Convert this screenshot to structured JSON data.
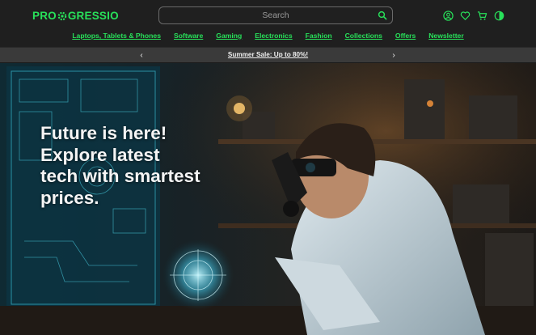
{
  "brand": {
    "name_left": "PRO",
    "name_right": "GRESSIO",
    "accent": "#28e05a"
  },
  "search": {
    "placeholder": "Search",
    "icon": "search-icon"
  },
  "header_icons": [
    "user-icon",
    "heart-icon",
    "cart-icon",
    "theme-toggle-icon"
  ],
  "nav": {
    "items": [
      {
        "label": "Laptops, Tablets & Phones"
      },
      {
        "label": "Software"
      },
      {
        "label": "Gaming"
      },
      {
        "label": "Electronics"
      },
      {
        "label": "Fashion"
      },
      {
        "label": "Collections"
      },
      {
        "label": "Offers"
      },
      {
        "label": "Newsletter"
      }
    ]
  },
  "promo": {
    "text": "Summer Sale: Up to 80%!",
    "prev_label": "‹",
    "next_label": "›"
  },
  "hero": {
    "headline": "Future is here! Explore latest tech with smartest prices."
  },
  "colors": {
    "header_bg": "#1f1f1f",
    "promo_bg": "#3a3a3a",
    "text_light": "#f4f4f4"
  }
}
